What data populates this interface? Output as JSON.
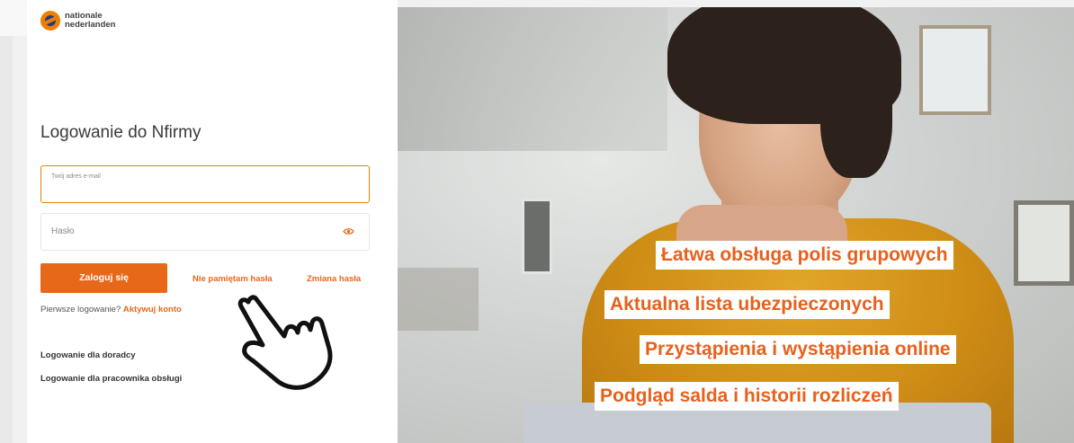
{
  "logo": {
    "line1": "nationale",
    "line2": "nederlanden"
  },
  "login": {
    "title": "Logowanie do Nfirmy",
    "email_placeholder": "Twój adres e-mail",
    "password_placeholder": "Hasło",
    "login_button": "Zaloguj się",
    "forgot_password": "Nie pamiętam hasła",
    "change_password": "Zmiana hasła",
    "first_login_text": "Pierwsze logowanie?",
    "activate_account": "Aktywuj konto",
    "advisor_login": "Logowanie dla doradcy",
    "staff_login": "Logowanie dla pracownika obsługi"
  },
  "features": [
    "Łatwa obsługa polis grupowych",
    "Aktualna lista ubezpieczonych",
    "Przystąpienia i wystąpienia online",
    "Podgląd salda i historii rozliczeń"
  ],
  "icons": {
    "eye": "eye-icon",
    "hand": "pointing-hand-icon"
  },
  "colors": {
    "accent": "#e8681a",
    "navy": "#1f3c88",
    "logo_orange": "#ee7f00"
  }
}
